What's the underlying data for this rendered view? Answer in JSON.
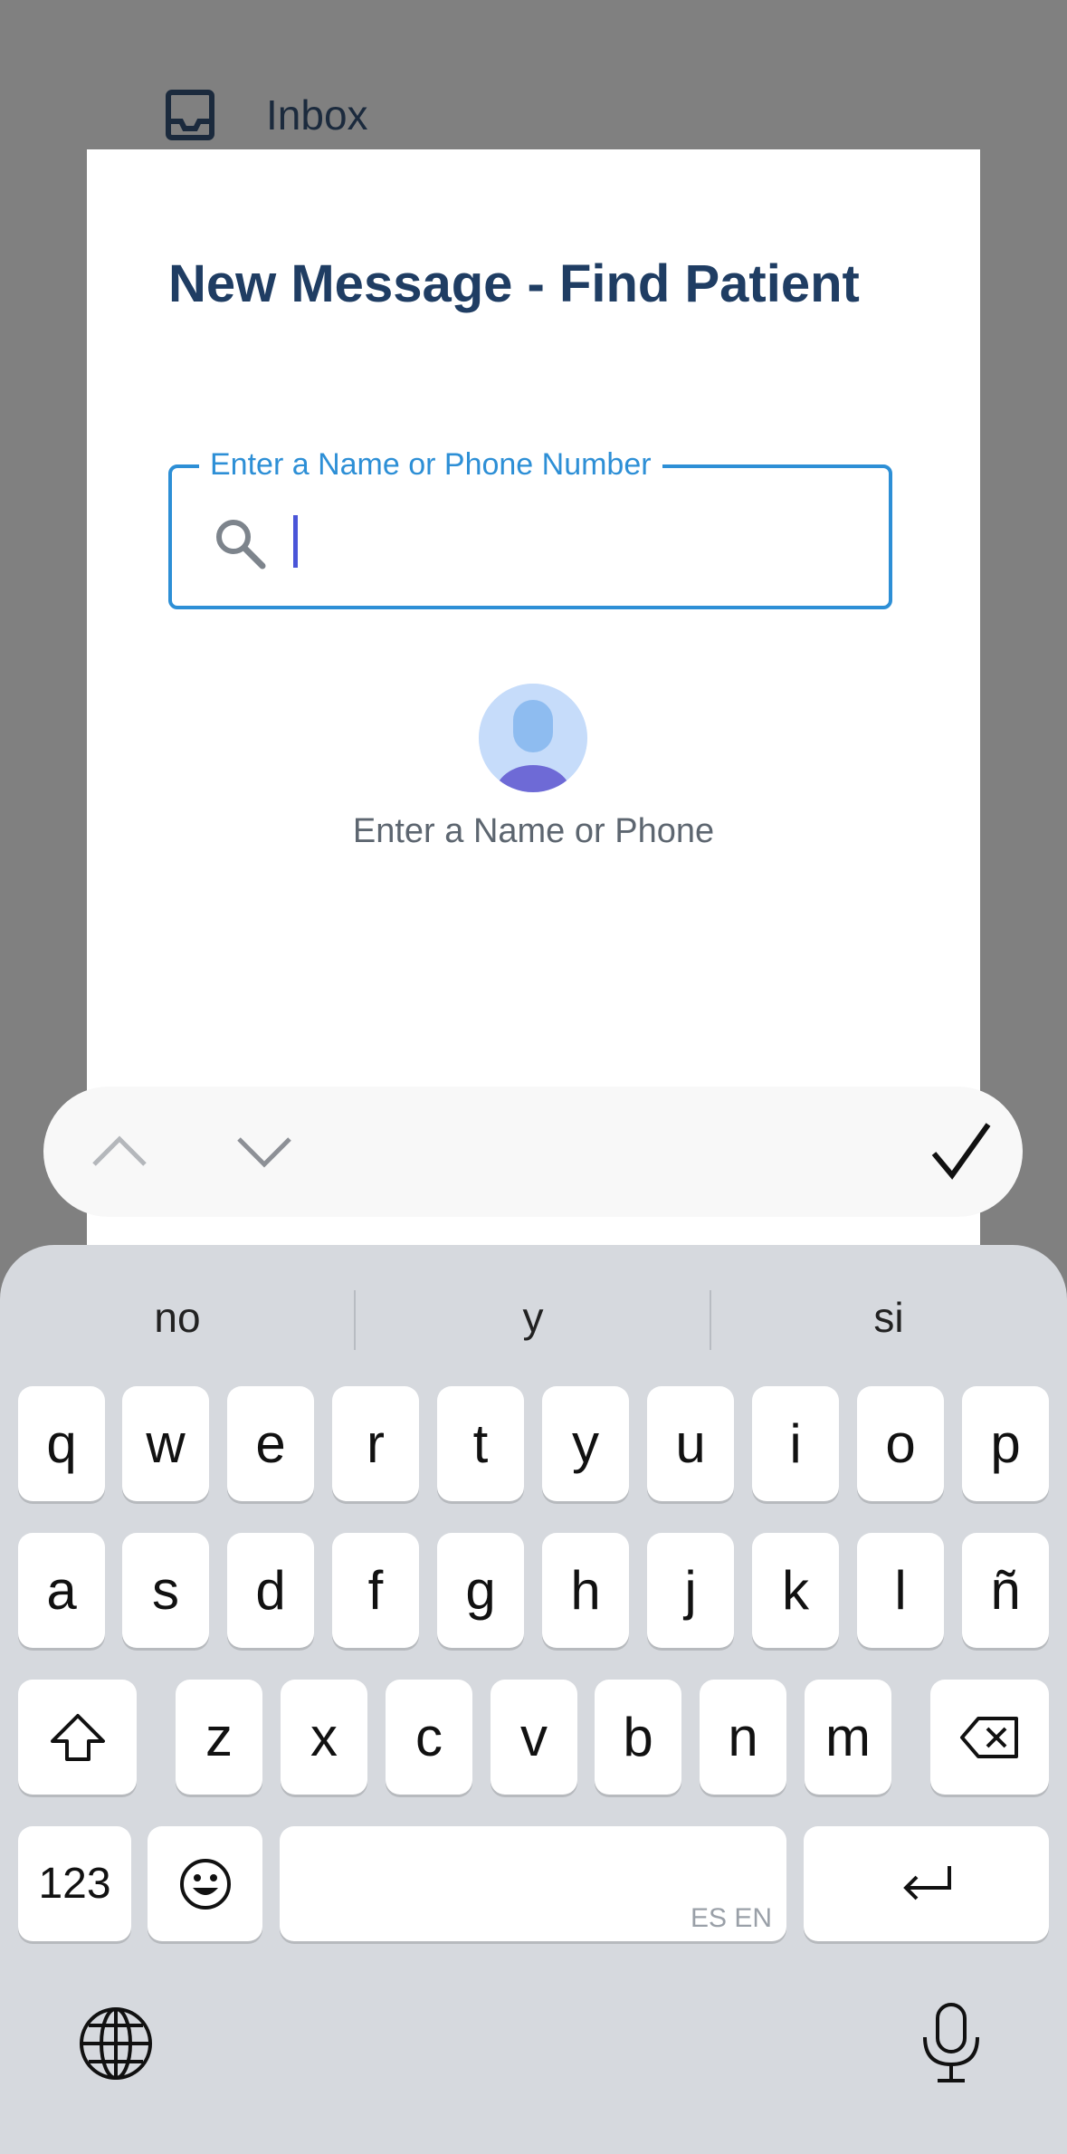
{
  "background": {
    "inbox_label": "Inbox"
  },
  "modal": {
    "title": "New Message - Find Patient",
    "search": {
      "label": "Enter a Name or Phone Number",
      "value": ""
    },
    "empty_state": "Enter a Name or Phone"
  },
  "keyboard": {
    "suggestions": [
      "no",
      "y",
      "si"
    ],
    "row1": [
      "q",
      "w",
      "e",
      "r",
      "t",
      "y",
      "u",
      "i",
      "o",
      "p"
    ],
    "row2": [
      "a",
      "s",
      "d",
      "f",
      "g",
      "h",
      "j",
      "k",
      "l",
      "ñ"
    ],
    "row3": [
      "z",
      "x",
      "c",
      "v",
      "b",
      "n",
      "m"
    ],
    "numbers_label": "123",
    "space_hint": "ES EN"
  },
  "colors": {
    "accent": "#2d8fd6",
    "title": "#1f3d63",
    "caret": "#4a55d8"
  }
}
